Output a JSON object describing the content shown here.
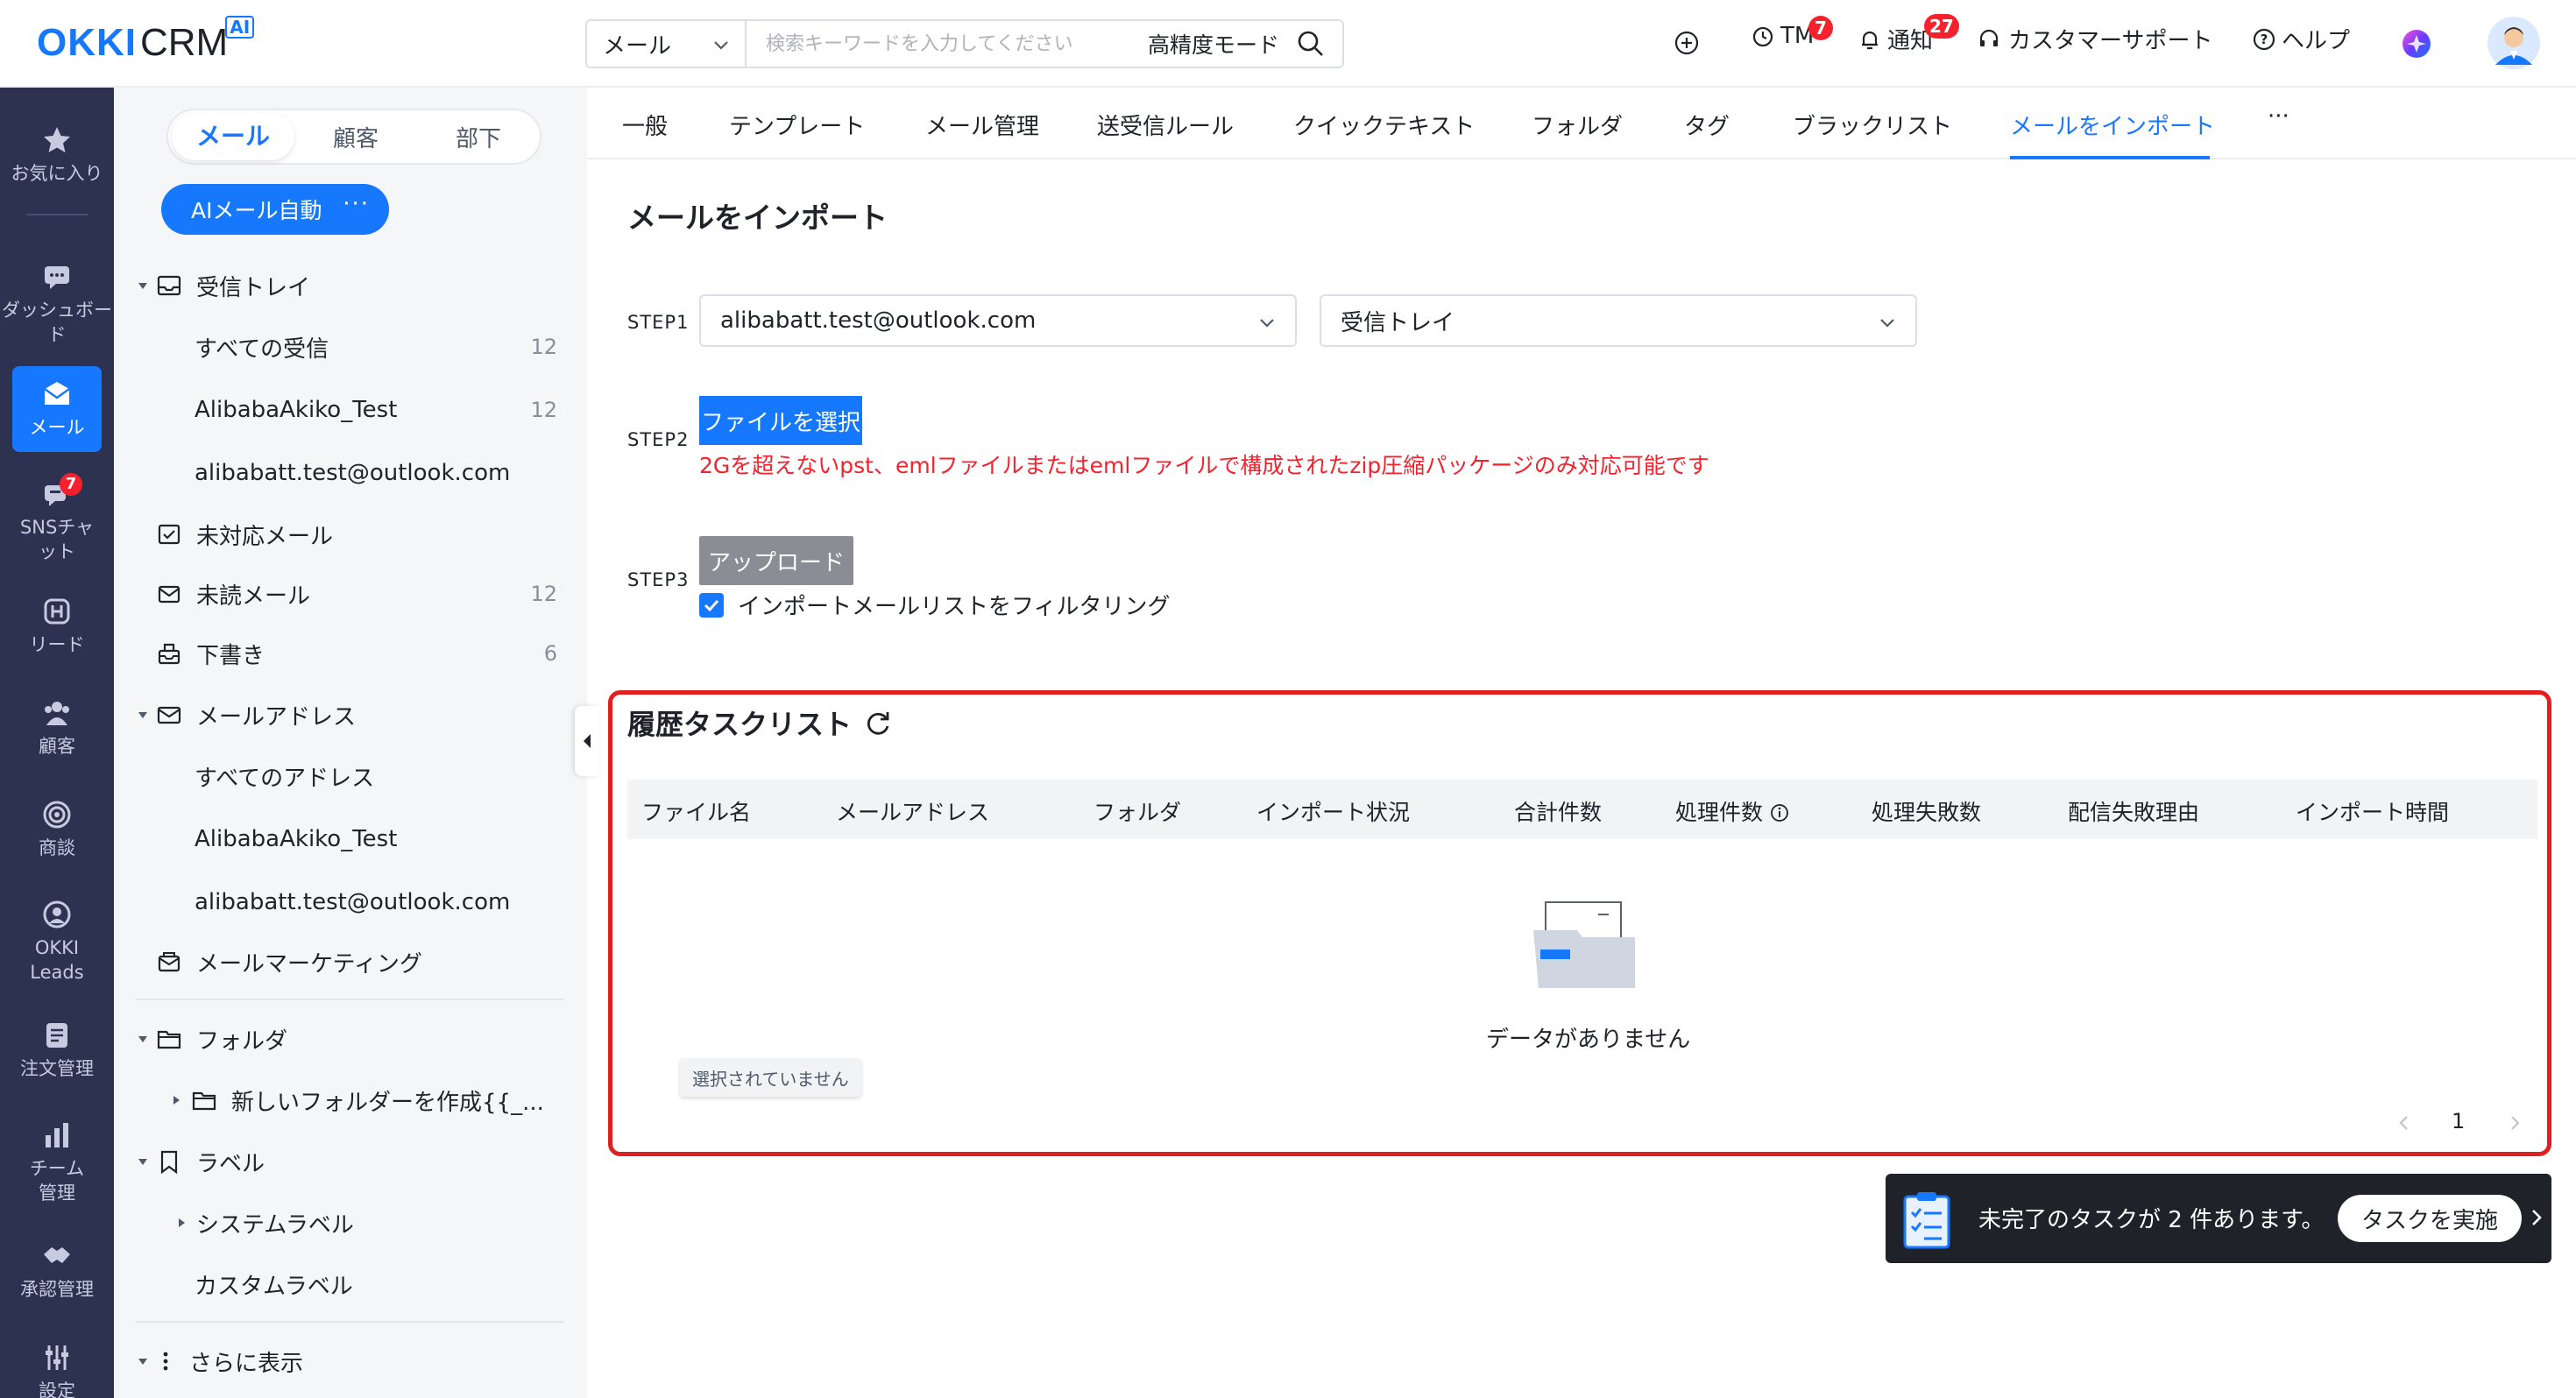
{
  "app": {
    "logo_main": "OKKI",
    "logo_sub": "CRM",
    "logo_badge": "AI"
  },
  "header": {
    "search_type": "メール",
    "search_placeholder": "検索キーワードを入力してください",
    "search_mode": "高精度モード",
    "tm_label": "TM",
    "tm_badge": "7",
    "notify_label": "通知",
    "notify_badge": "27",
    "support_label": "カスタマーサポート",
    "help_label": "ヘルプ"
  },
  "leftnav": {
    "items": [
      {
        "id": "favorites",
        "label": "お気に入り",
        "icon": "star-icon"
      },
      {
        "id": "dashboard",
        "label": "ダッシュボード",
        "icon": "chat-board-icon"
      },
      {
        "id": "mail",
        "label": "メール",
        "icon": "mail-icon"
      },
      {
        "id": "sns",
        "label": "SNSチャット",
        "icon": "sns-chat-icon",
        "badge": "7"
      },
      {
        "id": "leads",
        "label": "リード",
        "icon": "leads-icon"
      },
      {
        "id": "customers",
        "label": "顧客",
        "icon": "customers-icon"
      },
      {
        "id": "deals",
        "label": "商談",
        "icon": "target-icon"
      },
      {
        "id": "okki_leads",
        "label": "OKKI Leads",
        "icon": "okki-leads-icon"
      },
      {
        "id": "orders",
        "label": "注文管理",
        "icon": "order-icon"
      },
      {
        "id": "team",
        "label": "チーム管理",
        "icon": "team-chart-icon"
      },
      {
        "id": "approval",
        "label": "承認管理",
        "icon": "handshake-icon"
      },
      {
        "id": "settings",
        "label": "設定",
        "icon": "settings-sliders-icon"
      }
    ]
  },
  "sidebar": {
    "segments": [
      "メール",
      "顧客",
      "部下"
    ],
    "ai_button": "AIメール自動",
    "ai_more": "···",
    "inbox": "受信トレイ",
    "inbox_all": "すべての受信",
    "inbox_all_count": "12",
    "inbox_akiko": "AlibabaAkiko_Test",
    "inbox_akiko_count": "12",
    "inbox_outlook": "alibabatt.test@outlook.com",
    "unhandled": "未対応メール",
    "unread": "未読メール",
    "unread_count": "12",
    "drafts": "下書き",
    "drafts_count": "6",
    "addresses": "メールアドレス",
    "addr_all": "すべてのアドレス",
    "addr_akiko": "AlibabaAkiko_Test",
    "addr_outlook": "alibabatt.test@outlook.com",
    "marketing": "メールマーケティング",
    "folders": "フォルダ",
    "new_folder": "新しいフォルダーを作成{{_...",
    "labels": "ラベル",
    "system_labels": "システムラベル",
    "custom_labels": "カスタムラベル",
    "more": "さらに表示"
  },
  "tabs": {
    "items": [
      "一般",
      "テンプレート",
      "メール管理",
      "送受信ルール",
      "クイックテキスト",
      "フォルダ",
      "タグ",
      "ブラックリスト",
      "メールをインポート"
    ],
    "more": "···",
    "active_index": 8
  },
  "import": {
    "title": "メールをインポート",
    "step1": "STEP1",
    "step1_account": "alibabatt.test@outlook.com",
    "step1_folder": "受信トレイ",
    "step2": "STEP2",
    "select_file": "ファイルを選択",
    "warning": "2Gを超えないpst、emlファイルまたはemlファイルで構成されたzip圧縮パッケージのみ対応可能です",
    "step3": "STEP3",
    "upload": "アップロード",
    "filter_label": "インポートメールリストをフィルタリング"
  },
  "history": {
    "title": "履歴タスクリスト",
    "columns": [
      "ファイル名",
      "メールアドレス",
      "フォルダ",
      "インポート状況",
      "合計件数",
      "処理件数",
      "処理失敗数",
      "配信失敗理由",
      "インポート時間"
    ],
    "empty": "データがありません",
    "tooltip": "選択されていません",
    "page": "1"
  },
  "taskbar": {
    "text": "未完了のタスクが 2 件あります。",
    "button": "タスクを実施"
  },
  "colors": {
    "primary": "#1677ff",
    "nav_bg": "#2c3250",
    "danger": "#f5222d",
    "highlight_border": "#e02020"
  }
}
